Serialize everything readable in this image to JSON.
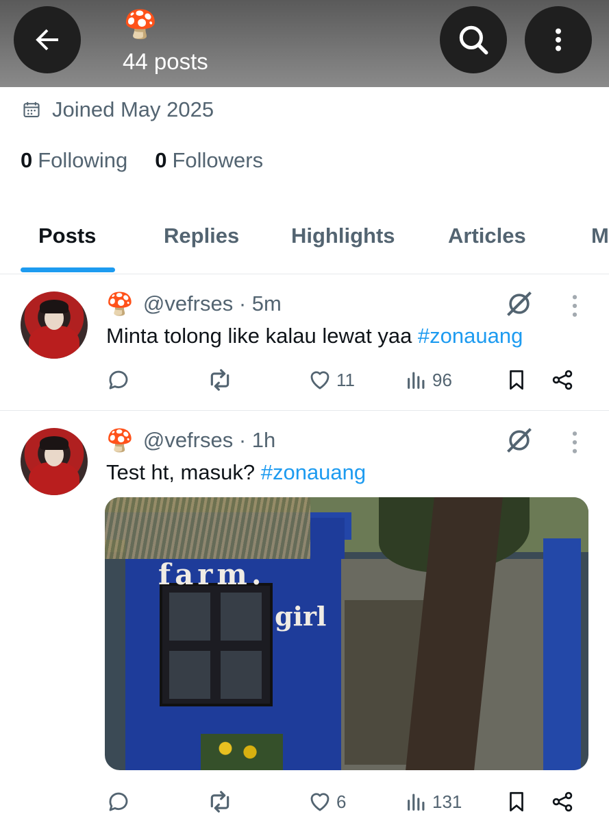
{
  "header": {
    "emoji": "🍄",
    "posts_count": "44 posts"
  },
  "profile": {
    "joined": "Joined May 2025",
    "following_count": "0",
    "following_label": "Following",
    "followers_count": "0",
    "followers_label": "Followers"
  },
  "tabs": [
    {
      "label": "Posts",
      "active": true
    },
    {
      "label": "Replies"
    },
    {
      "label": "Highlights"
    },
    {
      "label": "Articles"
    },
    {
      "label": "M"
    }
  ],
  "posts": [
    {
      "emoji": "🍄",
      "handle": "@vefrses",
      "time": "· 5m",
      "text": "Minta tolong like kalau lewat yaa ",
      "hashtag": "#zonauang",
      "likes": "11",
      "views": "96"
    },
    {
      "emoji": "🍄",
      "handle": "@vefrses",
      "time": "· 1h",
      "text": "Test ht, masuk? ",
      "hashtag": "#zonauang",
      "image_text_1": "farm.",
      "image_text_2": "girl",
      "likes": "6",
      "views": "131"
    }
  ],
  "colors": {
    "accent": "#1d9bf0",
    "secondary_text": "#536471",
    "primary_text": "#0f1419"
  }
}
